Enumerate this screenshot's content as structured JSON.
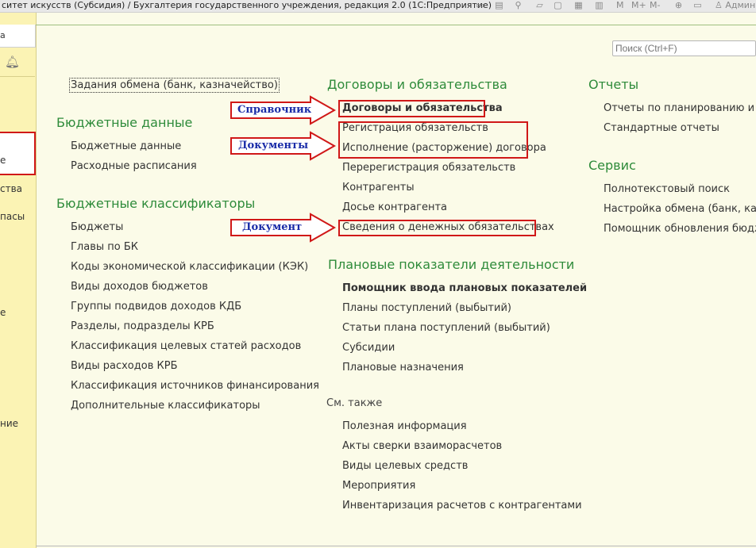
{
  "window": {
    "title": "ситет искусств (Субсидия) / Бухгалтерия государственного учреждения, редакция 2.0  (1С:Предприятие)",
    "user": "Админ",
    "toolbar_m": [
      "M",
      "M+",
      "M-"
    ]
  },
  "left_panel": {
    "tab_label": "а",
    "items": [
      "е",
      "ства",
      "пасы",
      "е",
      "ние"
    ]
  },
  "search": {
    "placeholder": "Поиск (Ctrl+F)"
  },
  "column1": {
    "exchange_tasks": "Задания обмена (банк, казначейство)",
    "budget_data": {
      "header": "Бюджетные данные",
      "items": [
        "Бюджетные данные",
        "Расходные расписания"
      ]
    },
    "budget_classifiers": {
      "header": "Бюджетные классификаторы",
      "items": [
        "Бюджеты",
        "Главы по БК",
        "Коды экономической классификации (КЭК)",
        "Виды доходов бюджетов",
        "Группы подвидов доходов КДБ",
        "Разделы, подразделы КРБ",
        "Классификация целевых статей расходов",
        "Виды расходов КРБ",
        "Классификация источников финансирования",
        "Дополнительные классификаторы"
      ]
    }
  },
  "column2": {
    "contracts": {
      "header": "Договоры и обязательства",
      "items": [
        "Договоры и обязательства",
        "Регистрация обязательств",
        "Исполнение (расторжение) договора",
        "Перерегистрация обязательств",
        "Контрагенты",
        "Досье контрагента",
        "Сведения о денежных обязательствах"
      ]
    },
    "planned": {
      "header": "Плановые показатели деятельности",
      "items": [
        "Помощник ввода плановых показателей",
        "Планы поступлений (выбытий)",
        "Статьи плана поступлений (выбытий)",
        "Субсидии",
        "Плановые назначения"
      ]
    },
    "see_also": {
      "header": "См. также",
      "items": [
        "Полезная информация",
        "Акты сверки взаиморасчетов",
        "Виды целевых средств",
        "Мероприятия",
        "Инвентаризация расчетов с контрагентами"
      ]
    }
  },
  "column3": {
    "reports": {
      "header": "Отчеты",
      "items": [
        "Отчеты по планированию и сан",
        "Стандартные отчеты"
      ]
    },
    "service": {
      "header": "Сервис",
      "items": [
        "Полнотекстовый поиск",
        "Настройка обмена (банк, казна",
        "Помощник обновления бюджет"
      ]
    }
  },
  "annotations": {
    "spravochnik": "Справочник",
    "dokumenty": "Документы",
    "dokument": "Документ",
    "arrow_color": "#d01818",
    "text_color": "#1a2ca8"
  }
}
